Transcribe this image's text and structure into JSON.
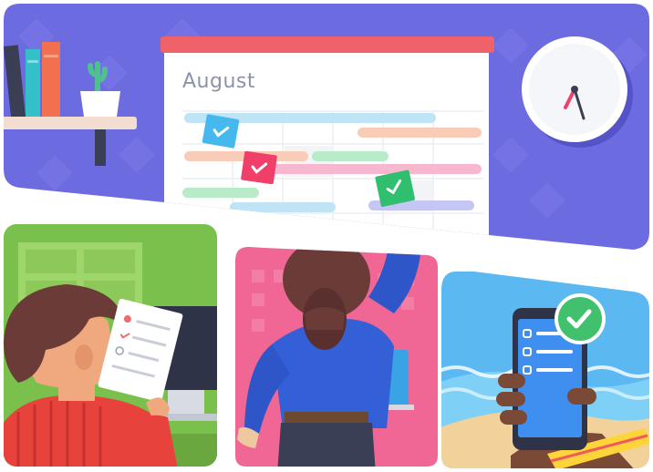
{
  "calendar": {
    "month": "August"
  },
  "colors": {
    "top_background": "#6d6be0",
    "calendar_header": "#f0626a",
    "panel_green": "#79c04d",
    "panel_pink": "#f06795",
    "panel_blue": "#5bb8f0",
    "check_badge": "#41c16d"
  },
  "icons": [
    "clock-icon",
    "checkmark-icon",
    "smartphone-icon",
    "plant-icon",
    "books-icon"
  ]
}
